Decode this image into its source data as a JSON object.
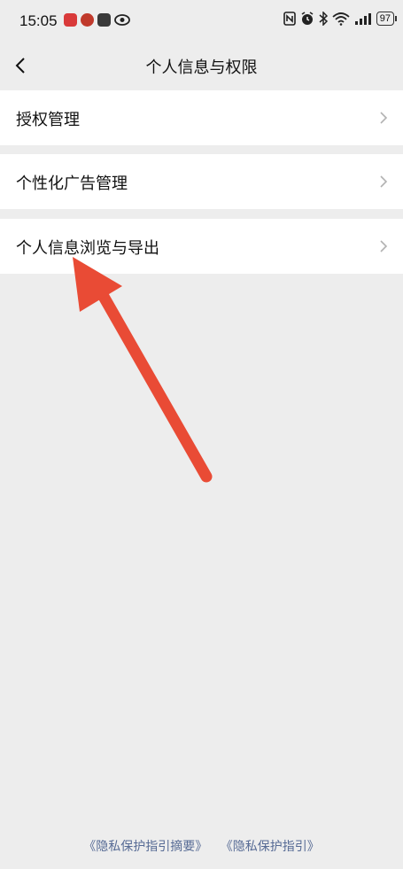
{
  "status_bar": {
    "time": "15:05",
    "battery": "97",
    "icons": [
      "app-notification-icon",
      "app-notification-icon",
      "app-notification-icon",
      "eye-icon",
      "nfc-icon",
      "alarm-icon",
      "bluetooth-icon",
      "wifi-icon",
      "signal-icon",
      "battery-icon"
    ]
  },
  "nav": {
    "title": "个人信息与权限"
  },
  "menu": [
    {
      "label": "授权管理"
    },
    {
      "label": "个性化广告管理"
    },
    {
      "label": "个人信息浏览与导出"
    }
  ],
  "footer": {
    "link_summary": "《隐私保护指引摘要》",
    "link_full": "《隐私保护指引》"
  },
  "colors": {
    "background": "#ededed",
    "link": "#576b95",
    "annotation_arrow": "#e94b35"
  }
}
